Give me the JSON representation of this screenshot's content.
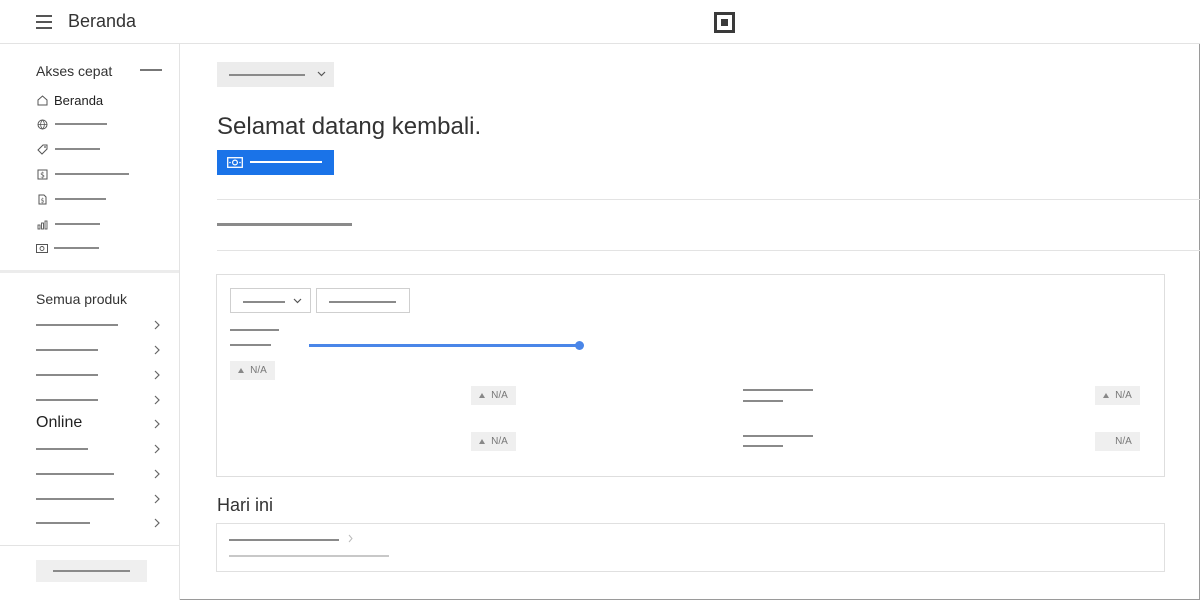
{
  "header": {
    "app_title": "Beranda",
    "menu_icon": "hamburger-menu-icon",
    "logo_icon": "square-logo-icon"
  },
  "sidebar": {
    "quick_access_heading": "Akses cepat",
    "quick_access_items": [
      {
        "label": "Beranda",
        "icon": "home-icon"
      },
      {
        "label": "",
        "icon": "globe-icon"
      },
      {
        "label": "",
        "icon": "tag-icon"
      },
      {
        "label": "",
        "icon": "dollar-box-icon"
      },
      {
        "label": "",
        "icon": "invoice-icon"
      },
      {
        "label": "",
        "icon": "bar-chart-icon"
      },
      {
        "label": "",
        "icon": "cash-icon"
      }
    ],
    "all_products_heading": "Semua produk",
    "product_items": [
      {
        "label": ""
      },
      {
        "label": ""
      },
      {
        "label": ""
      },
      {
        "label": ""
      },
      {
        "label": "Online"
      },
      {
        "label": ""
      },
      {
        "label": ""
      },
      {
        "label": ""
      },
      {
        "label": ""
      }
    ]
  },
  "main": {
    "welcome_title": "Selamat datang kembali.",
    "card": {
      "badges": [
        "N/A",
        "N/A",
        "N/A",
        "N/A",
        "N/A",
        "N/A"
      ]
    },
    "today_heading": "Hari ini"
  },
  "colors": {
    "primary": "#1a73e8",
    "slider": "#4a86e8",
    "placeholder_line": "#8a8a8a"
  }
}
